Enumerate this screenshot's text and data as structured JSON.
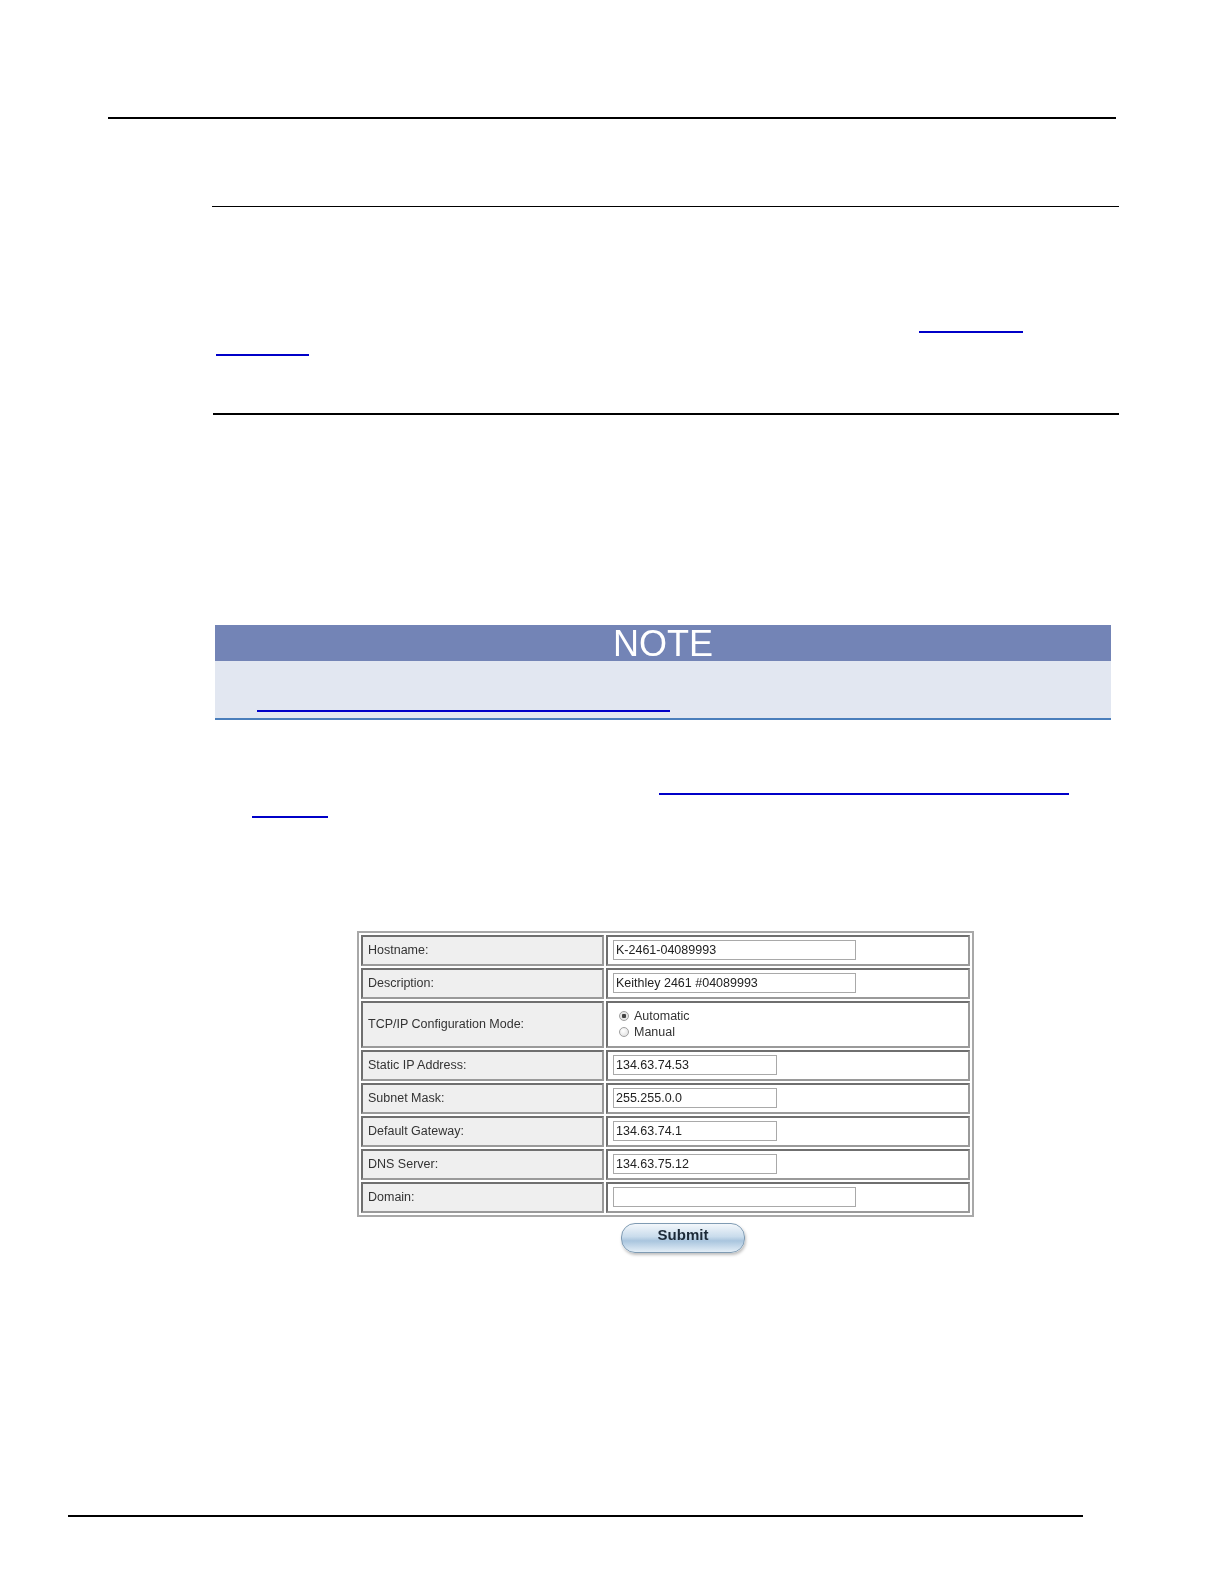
{
  "note": {
    "title": "NOTE"
  },
  "form": {
    "rows": [
      {
        "label": "Hostname:",
        "kind": "text",
        "value": "K-2461-04089993"
      },
      {
        "label": "Description:",
        "kind": "text",
        "value": "Keithley 2461 #04089993"
      },
      {
        "label": "TCP/IP Configuration Mode:",
        "kind": "radio",
        "options": [
          {
            "label": "Automatic",
            "selected": true
          },
          {
            "label": "Manual",
            "selected": false
          }
        ]
      },
      {
        "label": "Static IP Address:",
        "kind": "address",
        "value": "134.63.74.53"
      },
      {
        "label": "Subnet Mask:",
        "kind": "address",
        "value": "255.255.0.0"
      },
      {
        "label": "Default Gateway:",
        "kind": "address",
        "value": "134.63.74.1"
      },
      {
        "label": "DNS Server:",
        "kind": "address",
        "value": "134.63.75.12"
      },
      {
        "label": "Domain:",
        "kind": "text"
      }
    ],
    "submit_button": "Submit"
  }
}
